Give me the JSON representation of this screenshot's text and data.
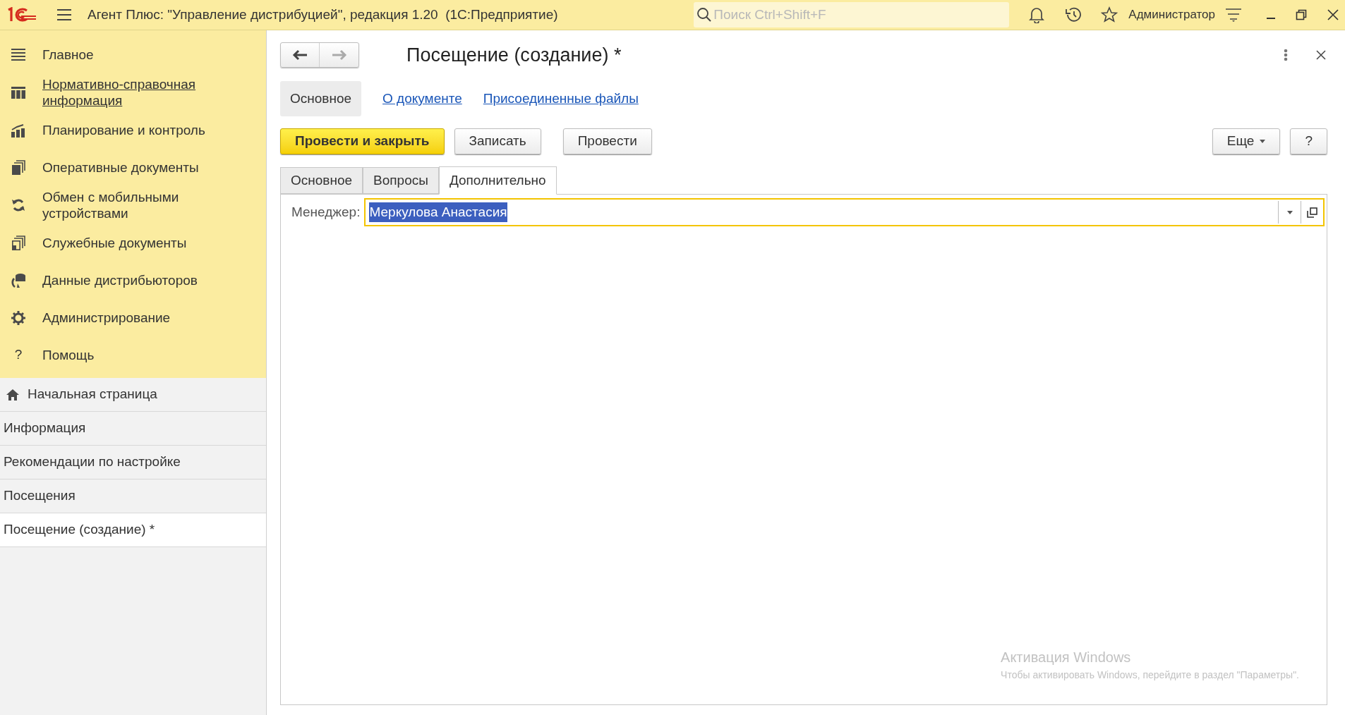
{
  "app_bar": {
    "title": "Агент Плюс: \"Управление дистрибуцией\", редакция 1.20  (1С:Предприятие)",
    "search": {
      "placeholder": "Поиск Ctrl+Shift+F"
    },
    "user": "Администратор"
  },
  "sections": [
    {
      "label": "Главное",
      "kind": "menu",
      "underlined": false
    },
    {
      "label": "Нормативно-справочная информация",
      "kind": "catalog",
      "underlined": true
    },
    {
      "label": "Планирование и контроль",
      "kind": "chart",
      "underlined": false
    },
    {
      "label": "Оперативные документы",
      "kind": "docs",
      "underlined": false
    },
    {
      "label": "Обмен с мобильными устройствами",
      "kind": "sync",
      "underlined": false
    },
    {
      "label": "Служебные документы",
      "kind": "servicedocs",
      "underlined": false
    },
    {
      "label": "Данные дистрибьюторов",
      "kind": "database",
      "underlined": false
    },
    {
      "label": "Администрирование",
      "kind": "gear",
      "underlined": false
    },
    {
      "label": "Помощь",
      "icon_text": "?",
      "underlined": false
    }
  ],
  "open_windows": [
    {
      "label": "Начальная страница",
      "kind": "home",
      "selected": false
    },
    {
      "label": "Информация",
      "kind": "plain",
      "selected": false
    },
    {
      "label": "Рекомендации по настройке",
      "kind": "plain",
      "selected": false
    },
    {
      "label": "Посещения",
      "kind": "plain",
      "selected": false
    },
    {
      "label": "Посещение (создание) *",
      "kind": "plain",
      "selected": true
    }
  ],
  "form": {
    "title": "Посещение (создание) *",
    "nav_tabs": [
      {
        "label": "Основное",
        "selected": true
      },
      {
        "label": "О документе",
        "selected": false
      },
      {
        "label": "Присоединенные файлы",
        "selected": false
      }
    ],
    "buttons": [
      {
        "label": "Провести и закрыть",
        "kind": "primary"
      },
      {
        "label": "Записать",
        "kind": "default"
      },
      {
        "label": "Провести",
        "kind": "default"
      }
    ],
    "more_button": "Еще",
    "help_button": "?",
    "tabs": [
      {
        "label": "Основное",
        "selected": false
      },
      {
        "label": "Вопросы",
        "selected": false
      },
      {
        "label": "Дополнительно",
        "selected": true
      }
    ],
    "fields": [
      {
        "label": "Менеджер:",
        "value": "Меркулова Анастасия",
        "focused": true,
        "text_selected": true
      }
    ]
  },
  "os_overlay": {
    "title": "Активация Windows",
    "text": "Чтобы активировать Windows, перейдите в раздел \"Параметры\"."
  }
}
